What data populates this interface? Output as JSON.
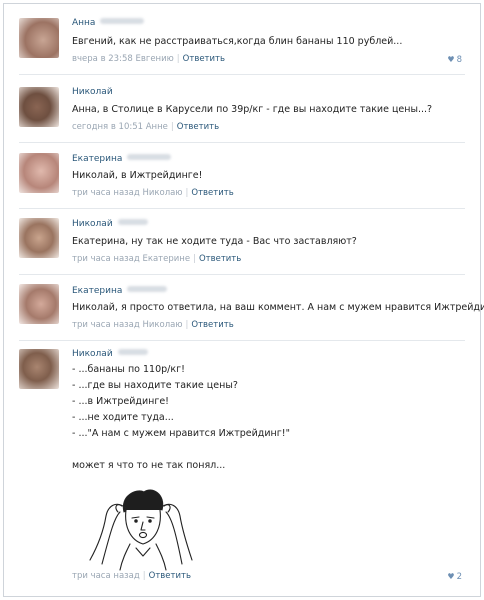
{
  "comments": [
    {
      "author": "Анна",
      "text": "Евгений, как не расстраиваться,когда блин бананы 110 рублей...",
      "time": "вчера в 23:58",
      "addressee": "Евгению",
      "reply": "Ответить",
      "likes": "8",
      "avatar_color": "#b08a78"
    },
    {
      "author": "Николай",
      "text": "Анна, в Столице в Карусели по 39р/кг - где вы находите такие цены...?",
      "time": "сегодня в 10:51",
      "addressee": "Анне",
      "reply": "Ответить",
      "avatar_color": "#9a7a66"
    },
    {
      "author": "Екатерина",
      "text": "Николай, в Ижтрейдинге!",
      "time": "три часа назад",
      "addressee": "Николаю",
      "reply": "Ответить",
      "avatar_color": "#c79a8c"
    },
    {
      "author": "Николай",
      "text": "Екатерина, ну так не ходите туда - Вас что заставляют?",
      "time": "три часа назад",
      "addressee": "Екатерине",
      "reply": "Ответить",
      "avatar_color": "#a88a72"
    },
    {
      "author": "Екатерина",
      "text": "Николай, я просто ответила, на ваш коммент. А нам с мужем нравится Ижтрейдинг!",
      "time": "три часа назад",
      "addressee": "Николаю",
      "reply": "Ответить",
      "avatar_color": "#b98b7c"
    },
    {
      "author": "Николай",
      "lines": [
        "- ...бананы по 110р/кг!",
        "- ...где вы находите такие цены?",
        "- ...в Ижтрейдинге!",
        "- ...не ходите туда...",
        "- ...\"А нам с мужем нравится Ижтрейдинг!\""
      ],
      "closing": "может я что то не так понял...",
      "time": "три часа назад",
      "reply": "Ответить",
      "likes": "2",
      "avatar_color": "#9c7f69"
    }
  ],
  "colors": {
    "link": "#2b587a",
    "meta": "#9aa6b3",
    "like": "#6d8fb3"
  }
}
